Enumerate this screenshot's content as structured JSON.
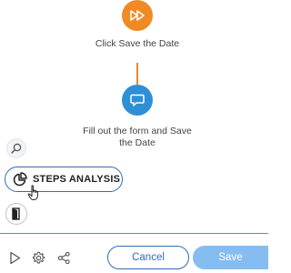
{
  "flow": {
    "nodes": [
      {
        "label": "Click Save the Date",
        "icon": "fast-forward-icon",
        "color": "#f08a24"
      },
      {
        "label": "Fill out the form and Save the Date",
        "icon": "speech-bubble-icon",
        "color": "#2f8fd6"
      }
    ],
    "connector_color": "#e58a3a"
  },
  "side_panel": {
    "zoom_icon": "zoom-icon",
    "steps_analysis_label": "STEPS ANALYSIS",
    "steps_analysis_icon": "pie-chart-icon",
    "exit_icon": "exit-door-icon"
  },
  "footer": {
    "icons": [
      "play-icon",
      "gear-icon",
      "share-icon"
    ],
    "cancel_label": "Cancel",
    "save_label": "Save",
    "accent_color": "#2f6db5",
    "save_bg": "#86bdf0"
  }
}
